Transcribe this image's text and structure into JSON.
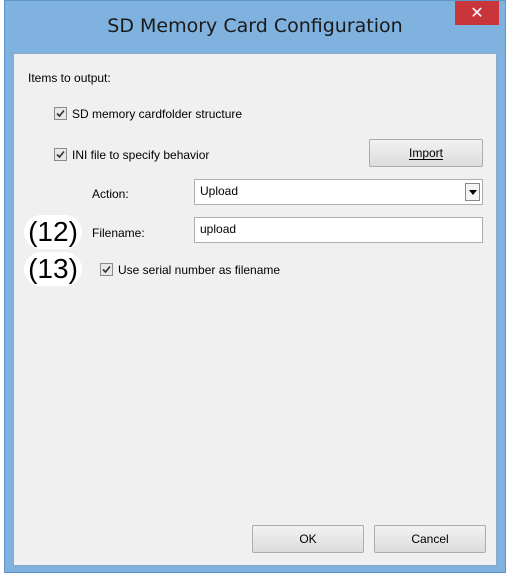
{
  "window": {
    "title": "SD Memory Card Configuration",
    "close_glyph": "✕"
  },
  "section": {
    "items_label": "Items to output:"
  },
  "options": {
    "folder_structure": {
      "label": "SD memory cardfolder structure",
      "checked": true
    },
    "ini_file": {
      "label": "INI file to specify behavior",
      "checked": true
    },
    "use_serial": {
      "label": "Use serial number as filename",
      "checked": true
    }
  },
  "import_button": {
    "label": "Import"
  },
  "action": {
    "label": "Action:",
    "value": "Upload"
  },
  "filename": {
    "label": "Filename:",
    "value": "upload"
  },
  "callouts": {
    "c12": "(12)",
    "c13": "(13)"
  },
  "footer": {
    "ok_label": "OK",
    "cancel_label": "Cancel"
  },
  "colors": {
    "frame": "#7fb2de",
    "close_button": "#c8363b",
    "client_bg": "#f0f0f0"
  }
}
